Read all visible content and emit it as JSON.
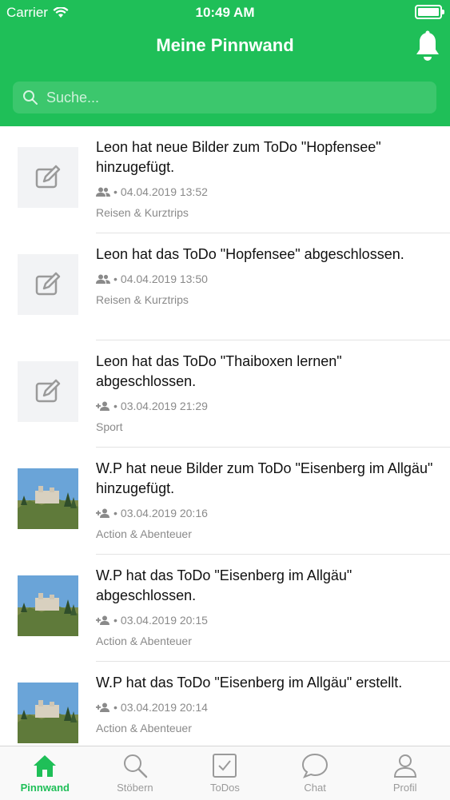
{
  "status_bar": {
    "carrier": "Carrier",
    "time": "10:49 AM"
  },
  "header": {
    "title": "Meine Pinnwand"
  },
  "search": {
    "placeholder": "Suche..."
  },
  "feed": {
    "items": [
      {
        "text": "Leon hat neue Bilder zum ToDo \"Hopfensee\" hinzugefügt.",
        "meta": "04.04.2019 13:52",
        "category": "Reisen & Kurztrips",
        "audience_icon": "group-icon",
        "thumb": "edit-icon"
      },
      {
        "text": "Leon hat das ToDo \"Hopfensee\" abgeschlossen.",
        "meta": "04.04.2019 13:50",
        "category": "Reisen & Kurztrips",
        "audience_icon": "group-icon",
        "thumb": "edit-icon"
      },
      {
        "text": "Leon hat das ToDo \"Thaiboxen lernen\" abgeschlossen.",
        "meta": "03.04.2019 21:29",
        "category": "Sport",
        "audience_icon": "add-person-icon",
        "thumb": "edit-icon"
      },
      {
        "text": "W.P hat neue Bilder zum ToDo \"Eisenberg im Allgäu\" hinzugefügt.",
        "meta": "03.04.2019 20:16",
        "category": "Action & Abenteuer",
        "audience_icon": "add-person-icon",
        "thumb": "castle-photo"
      },
      {
        "text": "W.P hat das ToDo \"Eisenberg im Allgäu\" abgeschlossen.",
        "meta": "03.04.2019 20:15",
        "category": "Action & Abenteuer",
        "audience_icon": "add-person-icon",
        "thumb": "castle-photo"
      },
      {
        "text": "W.P hat das ToDo \"Eisenberg im Allgäu\" erstellt.",
        "meta": "03.04.2019 20:14",
        "category": "Action & Abenteuer",
        "audience_icon": "add-person-icon",
        "thumb": "castle-photo"
      }
    ]
  },
  "tabbar": {
    "tabs": [
      {
        "label": "Pinnwand",
        "icon": "home-icon",
        "active": true
      },
      {
        "label": "Stöbern",
        "icon": "search-icon",
        "active": false
      },
      {
        "label": "ToDos",
        "icon": "checkbox-icon",
        "active": false
      },
      {
        "label": "Chat",
        "icon": "chat-bubble-icon",
        "active": false
      },
      {
        "label": "Profil",
        "icon": "person-icon",
        "active": false
      }
    ]
  },
  "colors": {
    "accent": "#1fbf58",
    "muted": "#8a8a8a",
    "text": "#111111"
  }
}
